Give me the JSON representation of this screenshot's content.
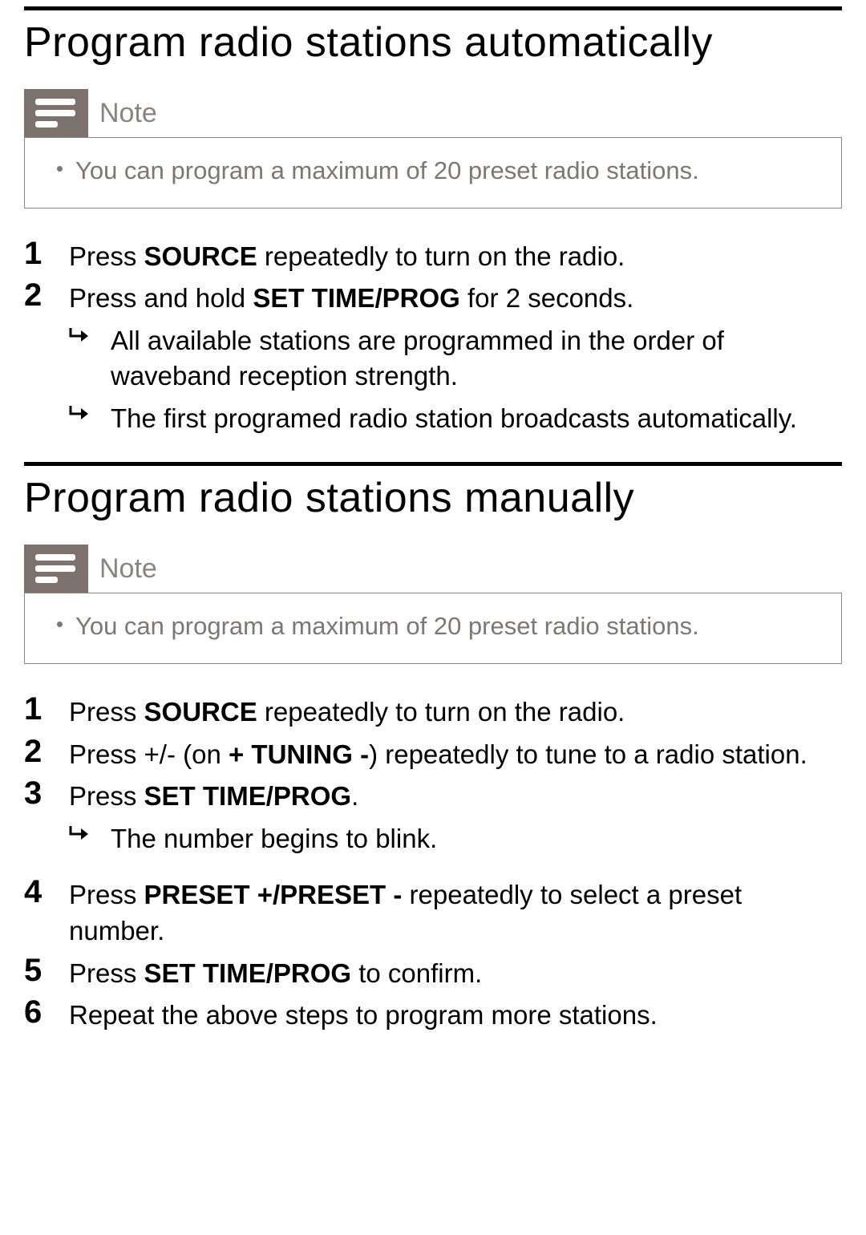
{
  "section1": {
    "title": "Program radio stations automatically",
    "note_label": "Note",
    "note_text": "You can program a maximum of 20 preset radio stations.",
    "steps": [
      {
        "num": "1",
        "parts": [
          {
            "t": "Press "
          },
          {
            "t": "SOURCE",
            "strong": true
          },
          {
            "t": " repeatedly to turn on the radio."
          }
        ],
        "subs": []
      },
      {
        "num": "2",
        "parts": [
          {
            "t": "Press and hold "
          },
          {
            "t": "SET TIME/PROG",
            "strong": true
          },
          {
            "t": " for 2 seconds."
          }
        ],
        "subs": [
          {
            "t": "All available stations are programmed in the order of waveband reception strength."
          },
          {
            "t": "The first programed radio station broadcasts automatically."
          }
        ]
      }
    ]
  },
  "section2": {
    "title": "Program radio stations manually",
    "note_label": "Note",
    "note_text": "You can program a maximum of 20 preset radio stations.",
    "steps": [
      {
        "num": "1",
        "parts": [
          {
            "t": "Press "
          },
          {
            "t": "SOURCE",
            "strong": true
          },
          {
            "t": " repeatedly to turn on the radio."
          }
        ],
        "subs": []
      },
      {
        "num": "2",
        "parts": [
          {
            "t": "Press +/- (on "
          },
          {
            "t": "+ TUNING -",
            "strong": true
          },
          {
            "t": ") repeatedly to tune to a radio station."
          }
        ],
        "subs": []
      },
      {
        "num": "3",
        "parts": [
          {
            "t": "Press "
          },
          {
            "t": "SET TIME/PROG",
            "strong": true
          },
          {
            "t": "."
          }
        ],
        "subs": [
          {
            "t": "The number begins to blink."
          }
        ]
      },
      {
        "num": "4",
        "parts": [
          {
            "t": "Press "
          },
          {
            "t": "PRESET +/PRESET -",
            "strong": true
          },
          {
            "t": " repeatedly to select a preset number."
          }
        ],
        "subs": []
      },
      {
        "num": "5",
        "parts": [
          {
            "t": "Press "
          },
          {
            "t": "SET TIME/PROG",
            "strong": true
          },
          {
            "t": " to confirm."
          }
        ],
        "subs": []
      },
      {
        "num": "6",
        "parts": [
          {
            "t": "Repeat the above steps to program more stations."
          }
        ],
        "subs": []
      }
    ]
  }
}
